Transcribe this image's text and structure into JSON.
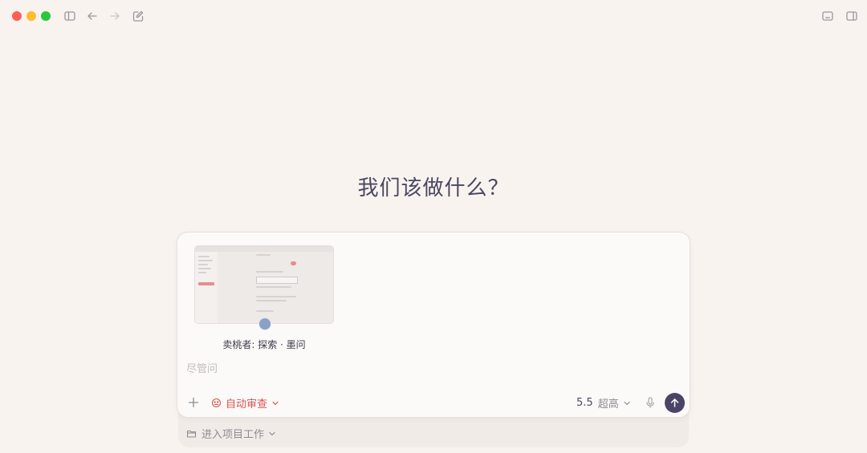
{
  "window": {
    "controls": [
      "close",
      "minimize",
      "maximize"
    ],
    "toolbar_icons": [
      "sidebar-toggle-icon",
      "back-arrow-icon",
      "forward-arrow-icon",
      "new-chat-icon"
    ],
    "right_icons": [
      "terminal-panel-icon",
      "right-panel-icon"
    ]
  },
  "main": {
    "heading": "我们该做什么？"
  },
  "composer": {
    "attachment": {
      "caption": "卖桃者: 探索 · 墨问"
    },
    "placeholder": "尽管问",
    "auto_review_label": "自动审查",
    "model_version": "5.5",
    "model_level": "超高"
  },
  "project": {
    "label": "进入项目工作"
  },
  "colors": {
    "background": "#f9f3f0",
    "accent_red": "#d9534f",
    "send_button": "#4a4567"
  }
}
